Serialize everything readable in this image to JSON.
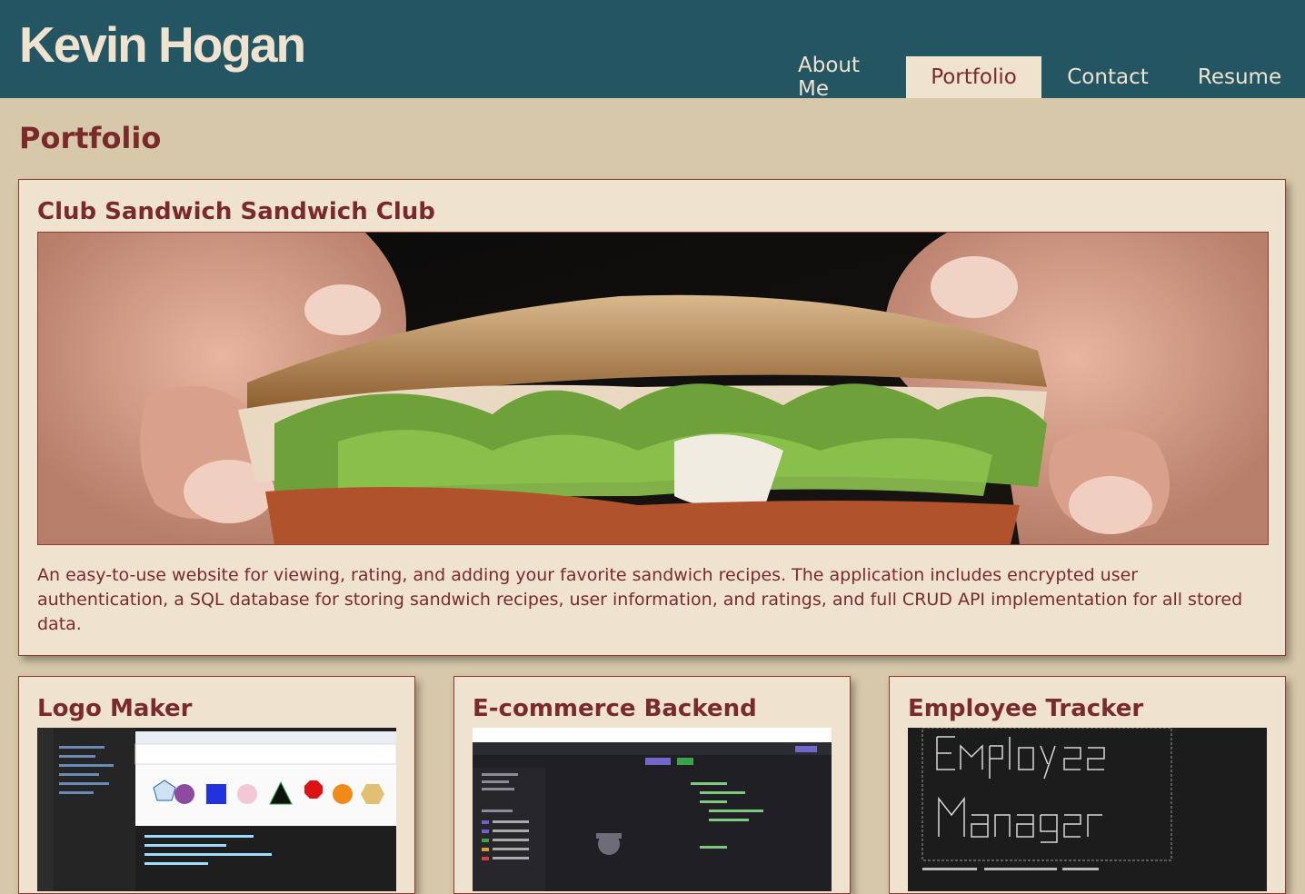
{
  "header": {
    "site_title": "Kevin Hogan",
    "nav": [
      "About Me",
      "Portfolio",
      "Contact",
      "Resume"
    ],
    "active_tab": "Portfolio"
  },
  "main": {
    "page_title": "Portfolio",
    "featured_project": {
      "title": "Club Sandwich Sandwich Club",
      "image": "sandwich-photo",
      "description": "An easy-to-use website for viewing, rating, and adding your favorite sandwich recipes. The application includes encrypted user authentication, a SQL database for storing sandwich recipes, user information, and ratings, and full CRUD API implementation for all stored data."
    },
    "projects": [
      {
        "title": "Logo Maker",
        "image": "code-editor-screenshot"
      },
      {
        "title": "E-commerce Backend",
        "image": "api-client-screenshot"
      },
      {
        "title": "Employee Tracker",
        "image": "terminal-ascii-banner-screenshot"
      }
    ]
  },
  "colors": {
    "header_bg": "#245562",
    "page_bg": "#d6c8a9",
    "card_bg": "#efe3d0",
    "accent": "#7a2a2a"
  }
}
